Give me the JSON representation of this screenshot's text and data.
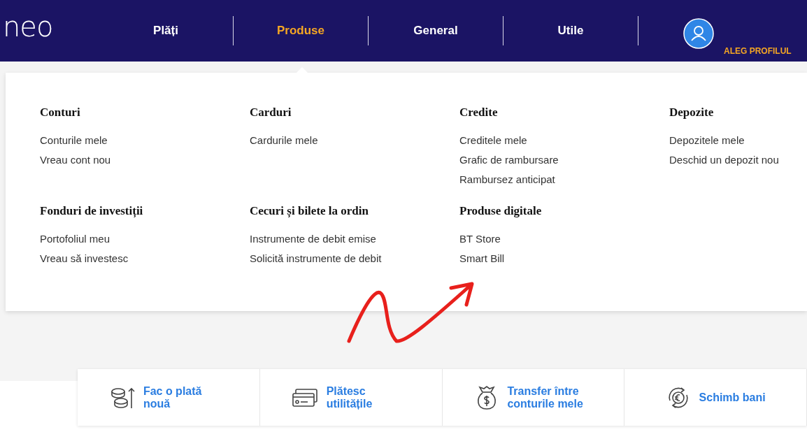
{
  "header": {
    "logo": "neo",
    "nav": [
      {
        "label": "Plăți",
        "selected": false
      },
      {
        "label": "Produse",
        "selected": true
      },
      {
        "label": "General",
        "selected": false
      },
      {
        "label": "Utile",
        "selected": false
      }
    ],
    "profile_label": "ALEG PROFILUL"
  },
  "menu": {
    "sections": [
      {
        "title": "Conturi",
        "items": [
          "Conturile mele",
          "Vreau cont nou"
        ]
      },
      {
        "title": "Carduri",
        "items": [
          "Cardurile mele"
        ]
      },
      {
        "title": "Credite",
        "items": [
          "Creditele mele",
          "Grafic de rambursare",
          "Rambursez anticipat"
        ]
      },
      {
        "title": "Depozite",
        "items": [
          "Depozitele mele",
          "Deschid un depozit nou"
        ]
      },
      {
        "title": "Fonduri de investiții",
        "items": [
          "Portofoliul meu",
          "Vreau să investesc"
        ]
      },
      {
        "title": "Cecuri și bilete la ordin",
        "items": [
          "Instrumente de debit emise",
          "Solicită instrumente de debit"
        ]
      },
      {
        "title": "Produse digitale",
        "items": [
          "BT Store",
          "Smart Bill"
        ]
      }
    ]
  },
  "quick_actions": [
    {
      "kind": "coins",
      "label": "Fac o plată nouă"
    },
    {
      "kind": "cards",
      "label": "Plătesc utilitățile"
    },
    {
      "kind": "moneybag",
      "label": "Transfer între conturile mele"
    },
    {
      "kind": "exchange",
      "label": "Schimb bani"
    }
  ]
}
